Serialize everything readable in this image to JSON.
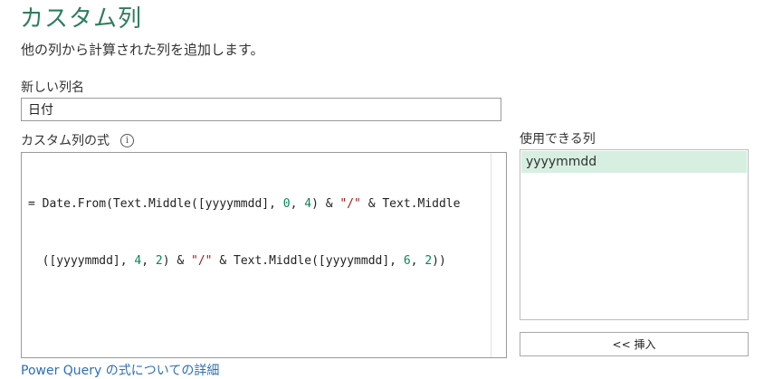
{
  "dialog": {
    "title": "カスタム列",
    "subtitle": "他の列から計算された列を追加します。"
  },
  "new_column": {
    "label": "新しい列名",
    "value": "日付"
  },
  "formula": {
    "label": "カスタム列の式",
    "info_icon": "info-icon",
    "line1_parts": [
      "= Date.From(Text.Middle([yyyymmdd], ",
      "0",
      ", ",
      "4",
      ") & ",
      "\"/\"",
      " & Text.Middle"
    ],
    "line2_parts": [
      "  ([yyyymmdd], ",
      "4",
      ", ",
      "2",
      ") & ",
      "\"/\"",
      " & Text.Middle([yyyymmdd], ",
      "6",
      ", ",
      "2",
      "))"
    ]
  },
  "available_columns": {
    "label": "使用できる列",
    "items": [
      "yyyymmdd"
    ],
    "selected": "yyyymmdd"
  },
  "insert_button": {
    "label": "<< 挿入"
  },
  "help_link": {
    "label": "Power Query の式についての詳細"
  },
  "colors": {
    "title": "#2e7d5b",
    "selected_item_bg": "#d6efe1",
    "link": "#2c6fb5",
    "number": "#098658",
    "string": "#a31515"
  }
}
